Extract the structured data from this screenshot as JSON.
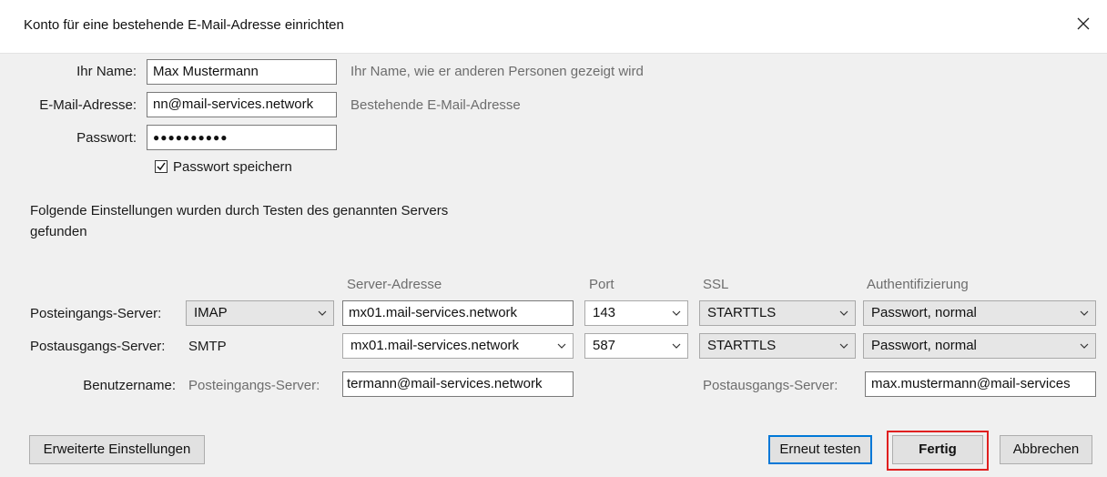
{
  "window": {
    "title": "Konto für eine bestehende E-Mail-Adresse einrichten",
    "close_glyph": "✕"
  },
  "identity": {
    "name_label": "Ihr Name:",
    "name_value": "Max Mustermann",
    "name_hint": "Ihr Name, wie er anderen Personen gezeigt wird",
    "email_label": "E-Mail-Adresse:",
    "email_value": "nn@mail-services.network",
    "email_hint": "Bestehende E-Mail-Adresse",
    "password_label": "Passwort:",
    "password_value": "●●●●●●●●●●",
    "save_password_label": "Passwort speichern",
    "save_password_checked": true
  },
  "found_text": {
    "line1": "Folgende Einstellungen wurden durch Testen des genannten Servers",
    "line2": "gefunden"
  },
  "columns": {
    "server_address": "Server-Adresse",
    "port": "Port",
    "ssl": "SSL",
    "auth": "Authentifizierung"
  },
  "incoming": {
    "label": "Posteingangs-Server:",
    "protocol": "IMAP",
    "server": "mx01.mail-services.network",
    "port": "143",
    "ssl": "STARTTLS",
    "auth": "Passwort, normal"
  },
  "outgoing": {
    "label": "Postausgangs-Server:",
    "protocol": "SMTP",
    "server": "mx01.mail-services.network",
    "port": "587",
    "ssl": "STARTTLS",
    "auth": "Passwort, normal"
  },
  "username": {
    "label": "Benutzername:",
    "incoming_label": "Posteingangs-Server:",
    "incoming_value": "termann@mail-services.network",
    "outgoing_label": "Postausgangs-Server:",
    "outgoing_value": "max.mustermann@mail-services"
  },
  "buttons": {
    "advanced": "Erweiterte Einstellungen",
    "retest": "Erneut testen",
    "done": "Fertig",
    "cancel": "Abbrechen"
  },
  "colors": {
    "highlight": "#e02020",
    "focus": "#0078d7"
  }
}
